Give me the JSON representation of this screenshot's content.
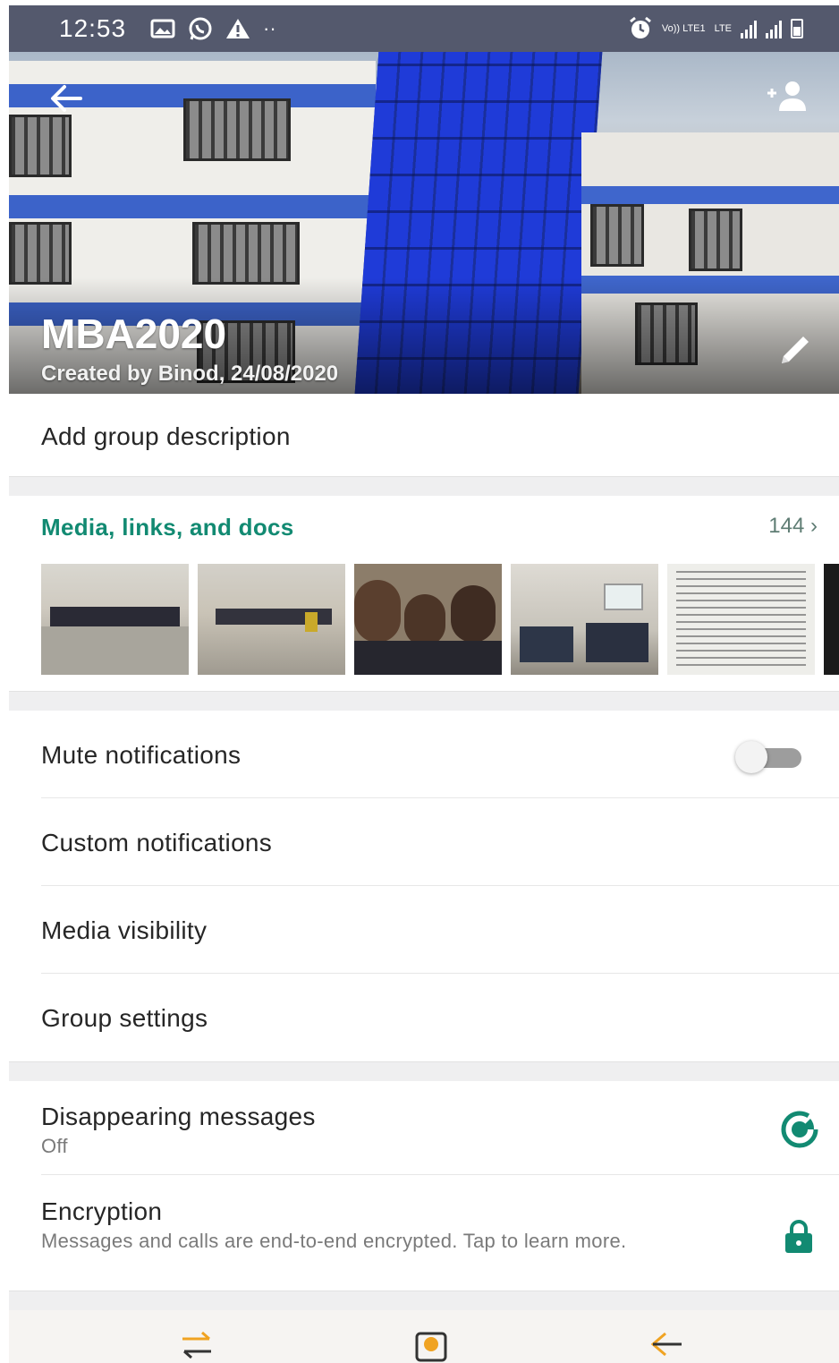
{
  "status_bar": {
    "time": "12:53",
    "volte_label": "Vo)) LTE1",
    "lte_label": "LTE"
  },
  "header": {
    "group_name": "MBA2020",
    "created_by": "Created by Binod, 24/08/2020",
    "icons": [
      "back-arrow-icon",
      "add-participant-icon",
      "edit-pencil-icon"
    ]
  },
  "description": {
    "label": "Add group description"
  },
  "media": {
    "title": "Media, links, and docs",
    "count": "144",
    "thumbnails": [
      "meeting-hall-photo-1",
      "meeting-hall-photo-2",
      "group-selfie-photo",
      "classroom-photo",
      "document-scan"
    ]
  },
  "settings": {
    "mute_label": "Mute notifications",
    "mute_on": false,
    "custom_label": "Custom notifications",
    "visibility_label": "Media visibility",
    "group_settings_label": "Group settings"
  },
  "privacy": {
    "disappearing_label": "Disappearing messages",
    "disappearing_value": "Off",
    "encryption_label": "Encryption",
    "encryption_desc": "Messages and calls are end-to-end encrypted. Tap to learn more."
  },
  "colors": {
    "accent": "#128a72",
    "status_bar": "#54596d"
  }
}
